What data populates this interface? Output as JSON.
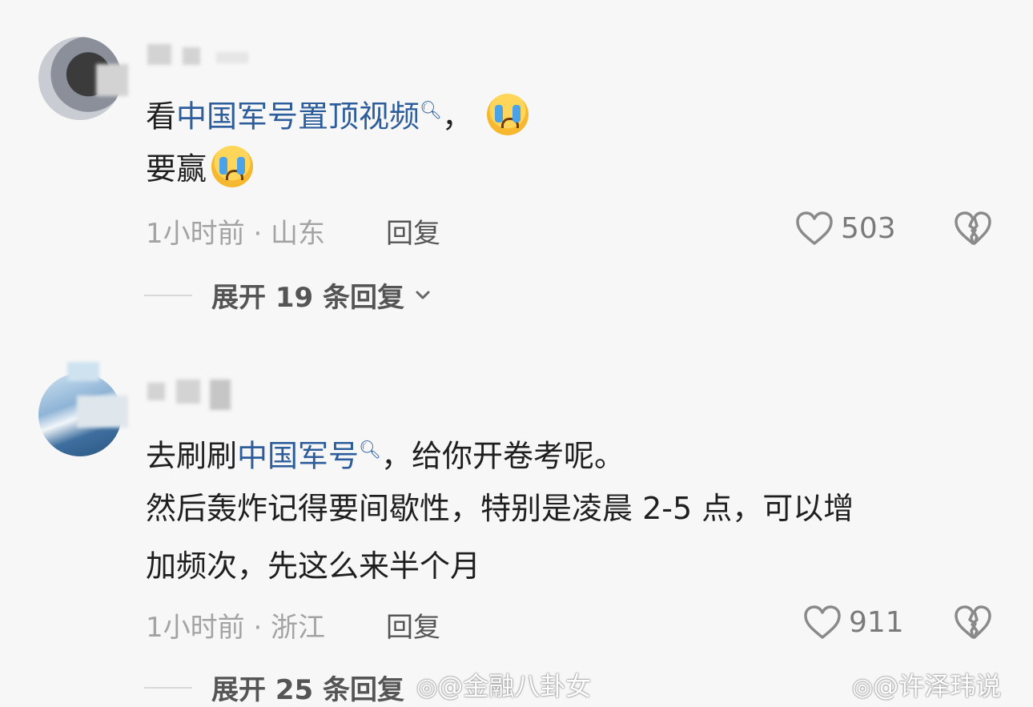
{
  "comments": [
    {
      "username": "",
      "text_line1_prefix": "看",
      "text_line1_link": "中国军号置顶视频",
      "text_line1_suffix": "，",
      "text_line2": "要赢",
      "time_location": "1小时前 · 山东",
      "reply_label": "回复",
      "likes": "503",
      "expand_label": "展开 19 条回复"
    },
    {
      "username": "",
      "text_line1_prefix": "去刷刷",
      "text_line1_link": "中国军号",
      "text_line1_suffix": "，给你开卷考呢。",
      "text_line2": "然后轰炸记得要间歇性，特别是凌晨 2-5 点，可以增",
      "text_line3": "加频次，先这么来半个月",
      "time_location": "1小时前 · 浙江",
      "reply_label": "回复",
      "likes": "911",
      "expand_label": "展开 25 条回复"
    }
  ],
  "watermarks": [
    "@金融八卦女",
    "@许泽玮说"
  ],
  "icons": {
    "search": "search-icon",
    "like": "heart-icon",
    "dislike": "broken-heart-icon",
    "expand": "chevron-down-icon",
    "emoji": "crying-face-icon"
  }
}
